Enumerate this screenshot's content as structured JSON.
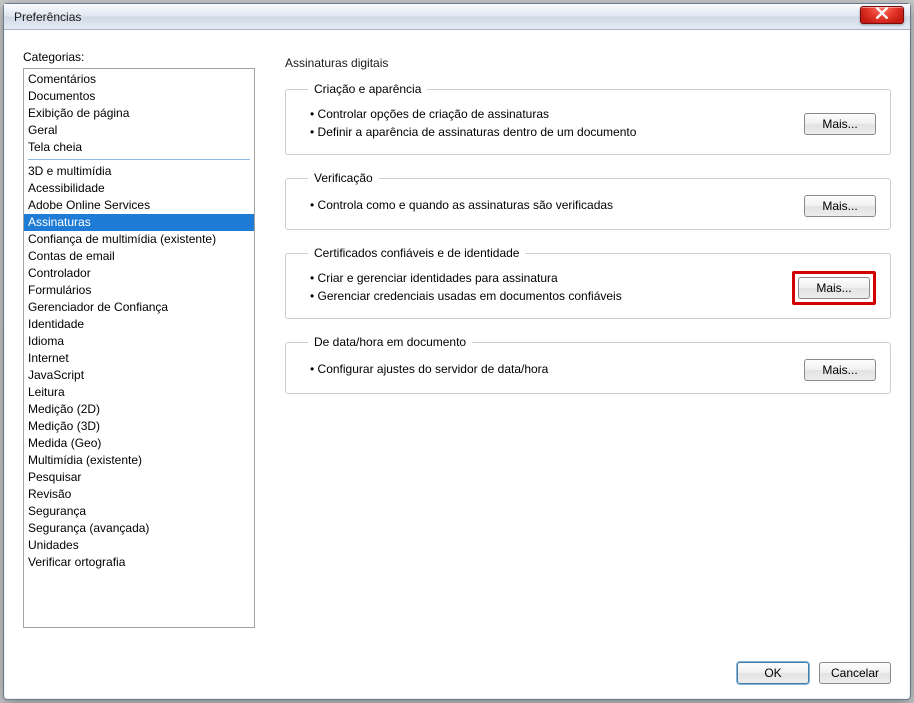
{
  "window": {
    "title": "Preferências"
  },
  "sidebar": {
    "label": "Categorias:",
    "groups": [
      [
        "Comentários",
        "Documentos",
        "Exibição de página",
        "Geral",
        "Tela cheia"
      ],
      [
        "3D e multimídia",
        "Acessibilidade",
        "Adobe Online Services",
        "Assinaturas",
        "Confiança de multimídia (existente)",
        "Contas de email",
        "Controlador",
        "Formulários",
        "Gerenciador de Confiança",
        "Identidade",
        "Idioma",
        "Internet",
        "JavaScript",
        "Leitura",
        "Medição (2D)",
        "Medição (3D)",
        "Medida (Geo)",
        "Multimídia (existente)",
        "Pesquisar",
        "Revisão",
        "Segurança",
        "Segurança (avançada)",
        "Unidades",
        "Verificar ortografia"
      ]
    ],
    "selected": "Assinaturas"
  },
  "panel": {
    "title": "Assinaturas digitais",
    "sections": [
      {
        "legend": "Criação e aparência",
        "lines": [
          "Controlar opções de criação de assinaturas",
          "Definir a aparência de assinaturas dentro de um documento"
        ],
        "button": "Mais...",
        "highlight": false
      },
      {
        "legend": "Verificação",
        "lines": [
          "Controla como e quando as assinaturas são verificadas"
        ],
        "button": "Mais...",
        "highlight": false
      },
      {
        "legend": "Certificados confiáveis e de identidade",
        "lines": [
          "Criar e gerenciar identidades para assinatura",
          "Gerenciar credenciais usadas em documentos confiáveis"
        ],
        "button": "Mais...",
        "highlight": true
      },
      {
        "legend": "De data/hora em documento",
        "lines": [
          "Configurar ajustes do servidor de data/hora"
        ],
        "button": "Mais...",
        "highlight": false
      }
    ]
  },
  "footer": {
    "ok": "OK",
    "cancel": "Cancelar"
  }
}
